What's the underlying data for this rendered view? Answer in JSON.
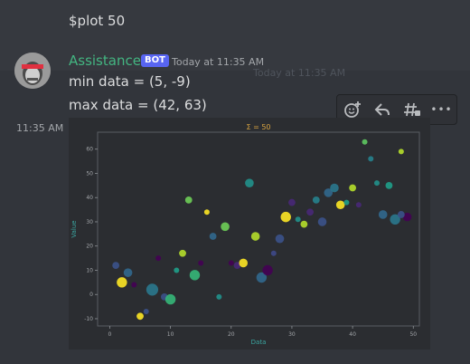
{
  "previous_message": {
    "text": "$plot 50"
  },
  "message": {
    "username": "Assistance",
    "bot_tag": "BOT",
    "timestamp": "Today at 11:35 AM",
    "ghost_timestamp": "Today at 11:35 AM",
    "lines": [
      "min data = (5, -9)",
      "max data = (42, 63)"
    ],
    "side_timestamp": "11:35 AM"
  },
  "toolbar": {
    "icons": [
      "add-reaction-icon",
      "reply-icon",
      "create-thread-icon",
      "more-icon"
    ],
    "more_label": "•••"
  },
  "colors": {
    "background": "#36393f",
    "username": "#43b581",
    "bot_tag": "#5865f2",
    "chart_bg": "#2b2d31",
    "chart_title": "#d9a441",
    "axis_label": "#3aa5a0"
  },
  "chart_data": {
    "type": "scatter",
    "title": "Σ = 50",
    "xlabel": "Data",
    "ylabel": "Value",
    "xlim": [
      -2,
      51
    ],
    "ylim": [
      -13,
      67
    ],
    "xticks": [
      0,
      10,
      20,
      30,
      40,
      50
    ],
    "yticks": [
      -10,
      0,
      10,
      20,
      30,
      40,
      50,
      60
    ],
    "grid": false,
    "points": [
      {
        "x": 1,
        "y": 12,
        "c": "#3b528b",
        "s": 3
      },
      {
        "x": 2,
        "y": 5,
        "c": "#fde725",
        "s": 5
      },
      {
        "x": 3,
        "y": 9,
        "c": "#31688e",
        "s": 4
      },
      {
        "x": 4,
        "y": 4,
        "c": "#440154",
        "s": 2
      },
      {
        "x": 5,
        "y": -9,
        "c": "#fde725",
        "s": 3
      },
      {
        "x": 6,
        "y": -7,
        "c": "#3b528b",
        "s": 2
      },
      {
        "x": 7,
        "y": 2,
        "c": "#2a788e",
        "s": 6
      },
      {
        "x": 8,
        "y": 15,
        "c": "#440154",
        "s": 2
      },
      {
        "x": 9,
        "y": -1,
        "c": "#3b528b",
        "s": 3
      },
      {
        "x": 10,
        "y": -2,
        "c": "#35b779",
        "s": 5
      },
      {
        "x": 11,
        "y": 10,
        "c": "#1f9e89",
        "s": 2
      },
      {
        "x": 12,
        "y": 17,
        "c": "#b5de2b",
        "s": 3
      },
      {
        "x": 13,
        "y": 39,
        "c": "#6ece58",
        "s": 3
      },
      {
        "x": 14,
        "y": 8,
        "c": "#35b779",
        "s": 5
      },
      {
        "x": 15,
        "y": 13,
        "c": "#440154",
        "s": 2
      },
      {
        "x": 16,
        "y": 34,
        "c": "#fde725",
        "s": 2
      },
      {
        "x": 17,
        "y": 24,
        "c": "#31688e",
        "s": 3
      },
      {
        "x": 18,
        "y": -1,
        "c": "#21918c",
        "s": 2
      },
      {
        "x": 19,
        "y": 28,
        "c": "#6ece58",
        "s": 4
      },
      {
        "x": 20,
        "y": 13,
        "c": "#440154",
        "s": 2
      },
      {
        "x": 21,
        "y": 12,
        "c": "#482878",
        "s": 3
      },
      {
        "x": 22,
        "y": 13,
        "c": "#fde725",
        "s": 4
      },
      {
        "x": 23,
        "y": 46,
        "c": "#21918c",
        "s": 4
      },
      {
        "x": 24,
        "y": 24,
        "c": "#b5de2b",
        "s": 4
      },
      {
        "x": 25,
        "y": 7,
        "c": "#31688e",
        "s": 5
      },
      {
        "x": 26,
        "y": 10,
        "c": "#440154",
        "s": 5
      },
      {
        "x": 27,
        "y": 17,
        "c": "#3e4989",
        "s": 2
      },
      {
        "x": 28,
        "y": 23,
        "c": "#3b528b",
        "s": 4
      },
      {
        "x": 29,
        "y": 32,
        "c": "#fde725",
        "s": 5
      },
      {
        "x": 30,
        "y": 38,
        "c": "#482878",
        "s": 3
      },
      {
        "x": 31,
        "y": 31,
        "c": "#21918c",
        "s": 2
      },
      {
        "x": 32,
        "y": 29,
        "c": "#b5de2b",
        "s": 3
      },
      {
        "x": 33,
        "y": 34,
        "c": "#482878",
        "s": 3
      },
      {
        "x": 34,
        "y": 39,
        "c": "#26828e",
        "s": 3
      },
      {
        "x": 35,
        "y": 30,
        "c": "#3b528b",
        "s": 4
      },
      {
        "x": 36,
        "y": 42,
        "c": "#31688e",
        "s": 4
      },
      {
        "x": 37,
        "y": 44,
        "c": "#2a788e",
        "s": 4
      },
      {
        "x": 38,
        "y": 37,
        "c": "#fde725",
        "s": 4
      },
      {
        "x": 39,
        "y": 38,
        "c": "#1f9e89",
        "s": 2
      },
      {
        "x": 40,
        "y": 44,
        "c": "#b5de2b",
        "s": 3
      },
      {
        "x": 41,
        "y": 37,
        "c": "#482878",
        "s": 2
      },
      {
        "x": 42,
        "y": 63,
        "c": "#5ec962",
        "s": 2
      },
      {
        "x": 43,
        "y": 56,
        "c": "#26828e",
        "s": 2
      },
      {
        "x": 44,
        "y": 46,
        "c": "#21918c",
        "s": 2
      },
      {
        "x": 45,
        "y": 33,
        "c": "#31688e",
        "s": 4
      },
      {
        "x": 46,
        "y": 45,
        "c": "#1f9e89",
        "s": 3
      },
      {
        "x": 47,
        "y": 31,
        "c": "#2a788e",
        "s": 5
      },
      {
        "x": 48,
        "y": 59,
        "c": "#b5de2b",
        "s": 2
      },
      {
        "x": 49,
        "y": 32,
        "c": "#440154",
        "s": 4
      },
      {
        "x": 48,
        "y": 33,
        "c": "#3b528b",
        "s": 3
      }
    ]
  }
}
